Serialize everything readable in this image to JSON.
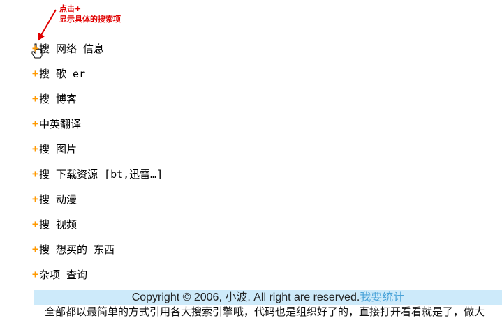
{
  "annotation": {
    "line1": "点击+",
    "line2": "显示具体的搜索项"
  },
  "menu": {
    "plus_symbol": "+",
    "items": [
      {
        "label": "搜 网络 信息"
      },
      {
        "label": "搜 歌 er"
      },
      {
        "label": "搜 博客"
      },
      {
        "label": "中英翻译"
      },
      {
        "label": "搜 图片"
      },
      {
        "label": "搜 下载资源 [bt,迅雷…]"
      },
      {
        "label": "搜 动漫"
      },
      {
        "label": "搜 视频"
      },
      {
        "label": "搜 想买的 东西"
      },
      {
        "label": "杂项 查询"
      }
    ]
  },
  "footer": {
    "copyright": "Copyright © 2006, 小波. All right are reserved.",
    "stat_link": "我要统计"
  },
  "cut_line": "全部都以最简单的方式引用各大搜索引擎哦，代码也是组织好了的，直接打开看看就是了，做大",
  "colors": {
    "plus": "#ff9900",
    "annotation": "#e00000",
    "footer_bg": "#cdeafa",
    "link": "#4aa3d8"
  }
}
